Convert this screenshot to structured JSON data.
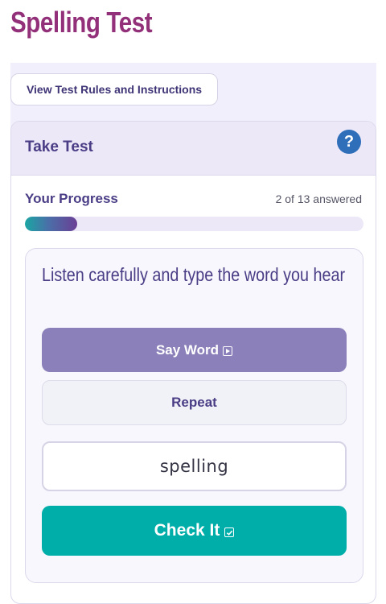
{
  "page": {
    "title": "Spelling Test"
  },
  "rules_button": {
    "label": "View Test Rules and Instructions"
  },
  "test_card": {
    "title": "Take Test",
    "help_icon": "question-circle-icon",
    "help_glyph": "?"
  },
  "progress": {
    "label": "Your Progress",
    "answered": 2,
    "total": 13,
    "status_text": "2 of 13 answered",
    "fraction": 0.154
  },
  "question": {
    "instruction": "Listen carefully and type the word you hear",
    "say_word_label": "Say Word",
    "say_word_icon": "play-box-icon",
    "repeat_label": "Repeat",
    "answer_value": "spelling",
    "check_label": "Check It",
    "check_icon": "check-box-icon"
  },
  "colors": {
    "title": "#93307a",
    "heading": "#4a3d86",
    "say_button": "#8b80b9",
    "check_button": "#00aea9",
    "help_icon": "#2f6fba",
    "band": "#f1effb"
  }
}
